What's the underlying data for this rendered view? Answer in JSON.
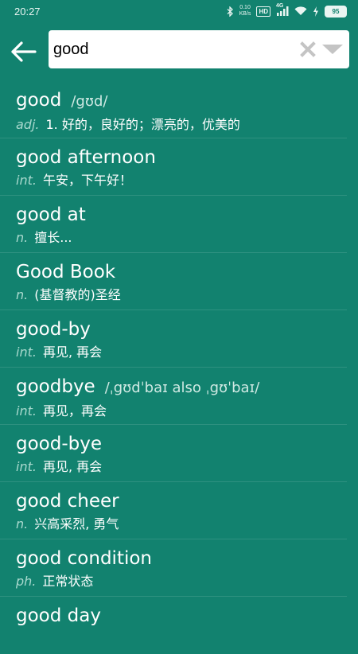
{
  "status_bar": {
    "time": "20:27",
    "net_speed_value": "0.10",
    "net_speed_unit": "KB/s",
    "hd_label": "HD",
    "network_label": "4G",
    "battery_level": "95"
  },
  "search": {
    "value": "good"
  },
  "results": [
    {
      "word": "good",
      "phonetic": "/gʊd/",
      "pos": "adj.",
      "definition": "1. 好的，良好的；漂亮的，优美的"
    },
    {
      "word": "good afternoon",
      "phonetic": "",
      "pos": "int.",
      "definition": "午安，下午好！"
    },
    {
      "word": "good at",
      "phonetic": "",
      "pos": "n.",
      "definition": "擅长..."
    },
    {
      "word": "Good Book",
      "phonetic": "",
      "pos": "n.",
      "definition": "(基督教的)圣经"
    },
    {
      "word": "good-by",
      "phonetic": "",
      "pos": "int.",
      "definition": "再见, 再会"
    },
    {
      "word": "goodbye",
      "phonetic": "/ˌgʊdˈbaɪ also ˌgʊˈbaɪ/",
      "pos": "int.",
      "definition": "再见，再会"
    },
    {
      "word": "good-bye",
      "phonetic": "",
      "pos": "int.",
      "definition": "再见, 再会"
    },
    {
      "word": "good cheer",
      "phonetic": "",
      "pos": "n.",
      "definition": "兴高采烈, 勇气"
    },
    {
      "word": "good condition",
      "phonetic": "",
      "pos": "ph.",
      "definition": "正常状态"
    },
    {
      "word": "good day",
      "phonetic": "",
      "pos": "",
      "definition": ""
    }
  ],
  "colors": {
    "background": "#12826f",
    "pos_text": "#a9d9ce",
    "caret": "#d81b60",
    "search_icons": "#c4c4c4"
  }
}
